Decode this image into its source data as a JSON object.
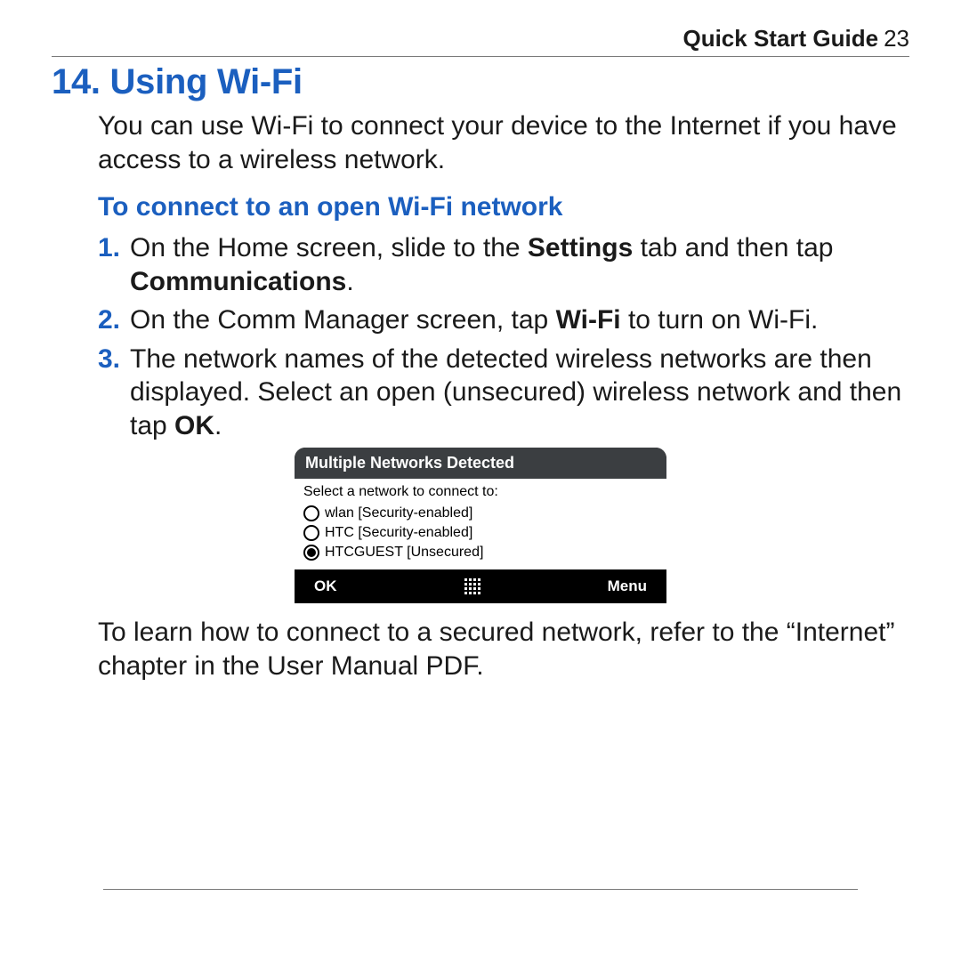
{
  "header": {
    "label": "Quick Start Guide",
    "page": "23"
  },
  "section": {
    "number": "14.",
    "title": "Using Wi-Fi"
  },
  "intro": "You can use Wi-Fi to connect your device to the Internet if you have access to a wireless network.",
  "subhead": "To connect to an open Wi-Fi network",
  "steps": {
    "n1": "1.",
    "s1a": "On the Home screen, slide to the ",
    "s1b": "Settings",
    "s1c": " tab and then tap ",
    "s1d": "Communications",
    "s1e": ".",
    "n2": "2.",
    "s2a": "On the Comm Manager screen, tap ",
    "s2b": "Wi-Fi",
    "s2c": " to turn on Wi-Fi.",
    "n3": "3.",
    "s3a": "The network names of the detected wireless networks are then displayed. Select an open (unsecured) wireless network and then tap ",
    "s3b": "OK",
    "s3c": "."
  },
  "phone": {
    "title": "Multiple Networks Detected",
    "prompt": "Select a network to connect to:",
    "options": {
      "o1": "wlan [Security-enabled]",
      "o2": "HTC [Security-enabled]",
      "o3": "HTCGUEST [Unsecured]"
    },
    "ok": "OK",
    "menu": "Menu"
  },
  "closing": "To learn how to connect to a secured network, refer to the “Internet” chapter in the User Manual PDF."
}
